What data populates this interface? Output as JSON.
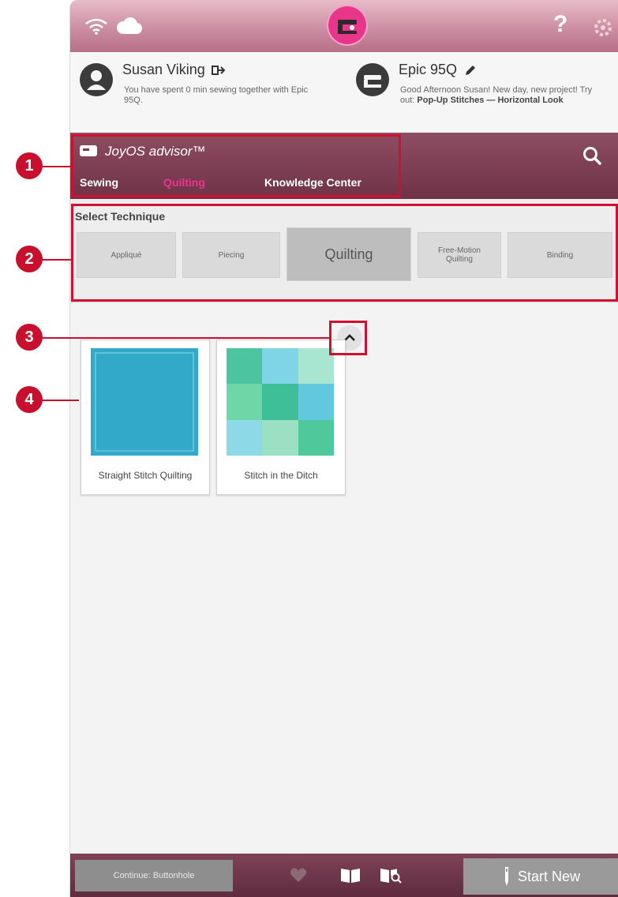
{
  "user": {
    "name": "Susan Viking",
    "status": "You have spent 0 min sewing together with Epic 95Q."
  },
  "machine": {
    "name": "Epic 95Q",
    "greeting_prefix": "Good Afternoon Susan! New day, new project! Try out: ",
    "greeting_highlight": "Pop-Up Stitches — Horizontal Look"
  },
  "advisor": {
    "title": "JoyOS advisor™",
    "tabs": [
      "Sewing",
      "Quilting",
      "Knowledge Center"
    ],
    "active_tab": "Quilting"
  },
  "technique": {
    "label": "Select Technique",
    "options": [
      "Appliqué",
      "Piecing",
      "Quilting",
      "Free-Motion Quilting",
      "Binding"
    ],
    "selected": "Quilting"
  },
  "cards": [
    {
      "label": "Straight Stitch Quilting"
    },
    {
      "label": "Stitch in the Ditch"
    }
  ],
  "bottom": {
    "continue_label": "Continue: Buttonhole",
    "start_new_label": "Start New"
  },
  "callouts": [
    "1",
    "2",
    "3",
    "4"
  ],
  "colors": {
    "accent_pink": "#e8368a",
    "advisor_bar": "#7a3a50",
    "callout_red": "#c8102e"
  }
}
